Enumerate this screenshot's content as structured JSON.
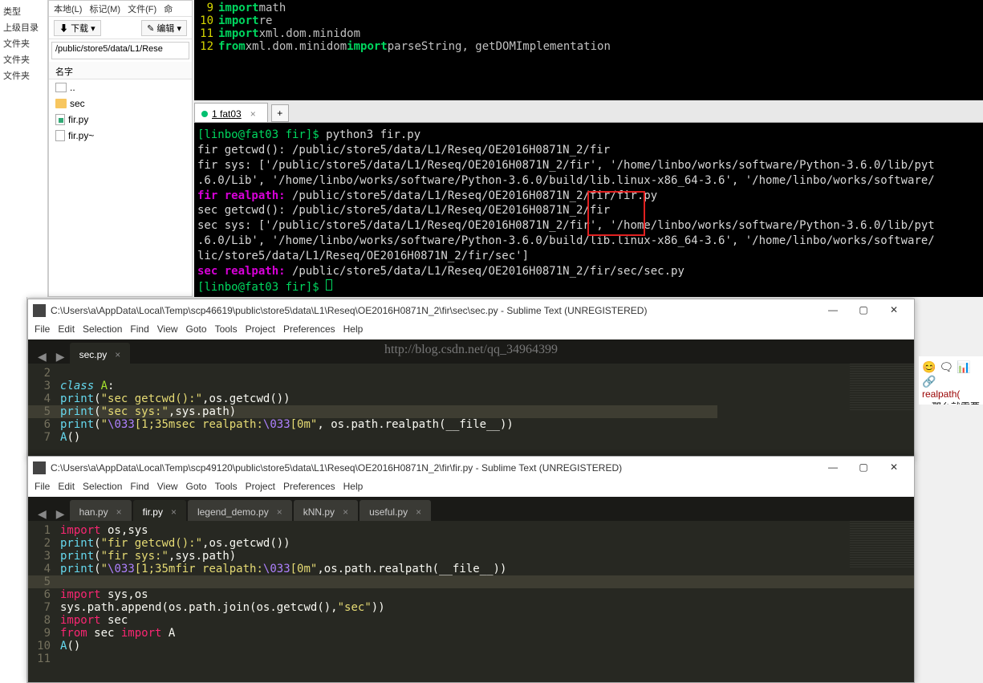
{
  "fm": {
    "left_items": [
      "类型",
      "上级目录",
      "文件夹",
      "文件夹",
      "文件夹"
    ],
    "menu": [
      "本地(L)",
      "标记(M)",
      "文件(F)",
      "命"
    ],
    "toolbar": {
      "download": "下载",
      "edit": "编辑"
    },
    "path": "/public/store5/data/L1/Rese",
    "header": "名字",
    "items": [
      {
        "icon": "up",
        "label": ".."
      },
      {
        "icon": "folder",
        "label": "sec"
      },
      {
        "icon": "py",
        "label": "fir.py"
      },
      {
        "icon": "file",
        "label": "fir.py~"
      }
    ]
  },
  "code_top": {
    "lines": [
      {
        "n": "9",
        "kw": "import",
        "rest": " math"
      },
      {
        "n": "10",
        "kw": "import",
        "rest": " re"
      },
      {
        "n": "11",
        "kw": "import",
        "rest": " xml.dom.minidom"
      },
      {
        "n": "12",
        "kw": "from",
        "mid": " xml.dom.minidom ",
        "kw2": "import",
        "rest": "  parseString, getDOMImplementation"
      }
    ]
  },
  "term": {
    "tab": "1 fat03",
    "add": "+",
    "prompt1": "[linbo@fat03 fir]$ ",
    "cmd1": "python3 fir.py",
    "l1": "fir getcwd(): /public/store5/data/L1/Reseq/OE2016H0871N_2/fir",
    "l2": "fir sys: ['/public/store5/data/L1/Reseq/OE2016H0871N_2/fir', '/home/linbo/works/software/Python-3.6.0/lib/pyt",
    "l3": ".6.0/Lib', '/home/linbo/works/software/Python-3.6.0/build/lib.linux-x86_64-3.6', '/home/linbo/works/software/",
    "l4a": "fir realpath:",
    "l4b": " /public/store5/data/L1/Reseq/OE2016H0871N_2/fir/fir.py",
    "l5": "sec getcwd(): /public/store5/data/L1/Reseq/OE2016H0871N_2/fir",
    "l6": "sec sys: ['/public/store5/data/L1/Reseq/OE2016H0871N_2/fir', '/home/linbo/works/software/Python-3.6.0/lib/pyt",
    "l7": ".6.0/Lib', '/home/linbo/works/software/Python-3.6.0/build/lib.linux-x86_64-3.6', '/home/linbo/works/software/",
    "l8": "lic/store5/data/L1/Reseq/OE2016H0871N_2/fir/sec']",
    "l9a": "sec realpath:",
    "l9b": " /public/store5/data/L1/Reseq/OE2016H0871N_2/fir/sec/sec.py",
    "prompt2": "[linbo@fat03 fir]$ "
  },
  "sublime1": {
    "title": "C:\\Users\\a\\AppData\\Local\\Temp\\scp46619\\public\\store5\\data\\L1\\Reseq\\OE2016H0871N_2\\fir\\sec\\sec.py - Sublime Text (UNREGISTERED)",
    "menu": [
      "File",
      "Edit",
      "Selection",
      "Find",
      "View",
      "Goto",
      "Tools",
      "Project",
      "Preferences",
      "Help"
    ],
    "tab": "sec.py",
    "watermark": "http://blog.csdn.net/qq_34964399"
  },
  "sublime2": {
    "title": "C:\\Users\\a\\AppData\\Local\\Temp\\scp49120\\public\\store5\\data\\L1\\Reseq\\OE2016H0871N_2\\fir\\fir.py - Sublime Text (UNREGISTERED)",
    "menu": [
      "File",
      "Edit",
      "Selection",
      "Find",
      "View",
      "Goto",
      "Tools",
      "Project",
      "Preferences",
      "Help"
    ],
    "tabs": [
      "han.py",
      "fir.py",
      "legend_demo.py",
      "kNN.py",
      "useful.py"
    ]
  },
  "web": {
    "text1": "realpath(",
    "text2": "，那么就需要"
  }
}
